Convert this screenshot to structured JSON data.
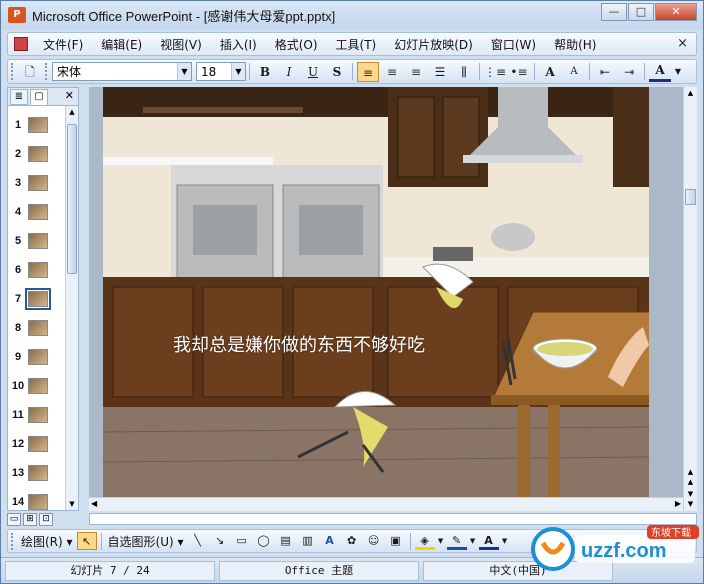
{
  "window": {
    "app_name": "Microsoft Office PowerPoint",
    "document_title": "- [感谢伟大母爱ppt.pptx]",
    "app_icon_glyph": "P"
  },
  "menu": {
    "items": [
      "文件(F)",
      "编辑(E)",
      "视图(V)",
      "插入(I)",
      "格式(O)",
      "工具(T)",
      "幻灯片放映(D)",
      "窗口(W)",
      "帮助(H)"
    ],
    "close_glyph": "×"
  },
  "toolbar": {
    "font_name": "宋体",
    "font_size": "18",
    "bold": "B",
    "italic": "I",
    "underline": "U",
    "shadow": "S",
    "align_left": "≡",
    "align_center": "≡",
    "align_right": "≡",
    "increase_font": "A",
    "decrease_font": "A",
    "font_color": "A"
  },
  "left_pane": {
    "slides": [
      {
        "num": "1"
      },
      {
        "num": "2"
      },
      {
        "num": "3"
      },
      {
        "num": "4"
      },
      {
        "num": "5"
      },
      {
        "num": "6"
      },
      {
        "num": "7"
      },
      {
        "num": "8"
      },
      {
        "num": "9"
      },
      {
        "num": "10"
      },
      {
        "num": "11"
      },
      {
        "num": "12"
      },
      {
        "num": "13"
      },
      {
        "num": "14"
      }
    ],
    "selected": "7"
  },
  "slide": {
    "caption": "我却总是嫌你做的东西不够好吃"
  },
  "draw_toolbar": {
    "draw_label": "绘图(R)",
    "autoshapes_label": "自选图形(U)"
  },
  "status": {
    "slide_info": "幻灯片 7 / 24",
    "theme": "Office 主题",
    "language": "中文(中国)"
  },
  "watermark": {
    "text": "uzzf.com",
    "sub": "东坡下载"
  },
  "colors": {
    "accent": "#fbd98a",
    "title_bar": "#c3d6ec",
    "close_red": "#c8432b"
  }
}
